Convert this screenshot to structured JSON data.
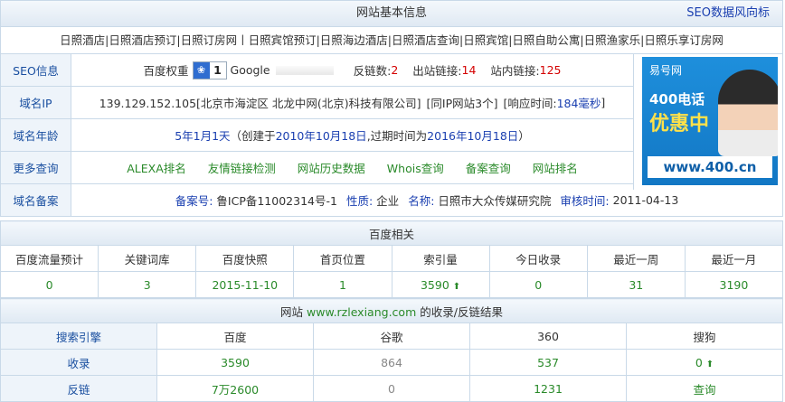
{
  "header": {
    "title": "网站基本信息",
    "right_link": "SEO数据风向标"
  },
  "keywords": "日照酒店|日照酒店预订|日照订房网丨日照宾馆预订|日照海边酒店|日照酒店查询|日照宾馆|日照自助公寓|日照渔家乐|日照乐享订房网",
  "seo": {
    "label": "SEO信息",
    "baidu_label": "百度权重",
    "baidu_value": "1",
    "google_label": "Google",
    "fanlian_label": "反链数:",
    "fanlian_value": "2",
    "out_label": "出站链接:",
    "out_value": "14",
    "in_label": "站内链接:",
    "in_value": "125"
  },
  "ip": {
    "label": "域名IP",
    "text": "139.129.152.105[北京市海淀区 北龙中网(北京)科技有限公司]",
    "same_ip": "[同IP网站3个]",
    "resp_label": "[响应时间:",
    "resp_value": "184毫秒",
    "resp_end": "]"
  },
  "age": {
    "label": "域名年龄",
    "value": "5年1月1天",
    "pre": "（创建于",
    "created": "2010年10月18日",
    "mid": ",过期时间为",
    "expire": "2016年10月18日",
    "post": "）"
  },
  "more": {
    "label": "更多查询",
    "links": [
      "ALEXA排名",
      "友情链接检测",
      "网站历史数据",
      "Whois查询",
      "备案查询",
      "网站排名"
    ]
  },
  "beian": {
    "label": "域名备案",
    "no_label": "备案号:",
    "no_value": "鲁ICP备11002314号-1",
    "type_label": "性质:",
    "type_value": "企业",
    "name_label": "名称:",
    "name_value": "日照市大众传媒研究院",
    "time_label": "审核时间:",
    "time_value": "2011-04-13"
  },
  "ad": {
    "brand": "易号网",
    "line1": "400电话",
    "line2": "优惠中",
    "url": "www.400.cn"
  },
  "baidu": {
    "title": "百度相关",
    "headers": [
      "百度流量预计",
      "关键词库",
      "百度快照",
      "首页位置",
      "索引量",
      "今日收录",
      "最近一周",
      "最近一月"
    ],
    "values": [
      "0",
      "3",
      "2015-11-10",
      "1",
      "3590",
      "0",
      "31",
      "3190"
    ]
  },
  "site": {
    "pre": "网站",
    "domain": "www.rzlexiang.com",
    "post": "的收录/反链结果",
    "headers": [
      "搜索引擎",
      "百度",
      "谷歌",
      "360",
      "搜狗"
    ],
    "rows": [
      {
        "label": "收录",
        "values": [
          "3590",
          "864",
          "537",
          "0"
        ]
      },
      {
        "label": "反链",
        "values": [
          "7万2600",
          "0",
          "1231",
          "查询"
        ]
      }
    ]
  },
  "colors": {
    "label_blue": "#1a4fa0",
    "header_bg": "#dfe9f3",
    "red": "#d40000",
    "green": "#2a8a2a"
  }
}
